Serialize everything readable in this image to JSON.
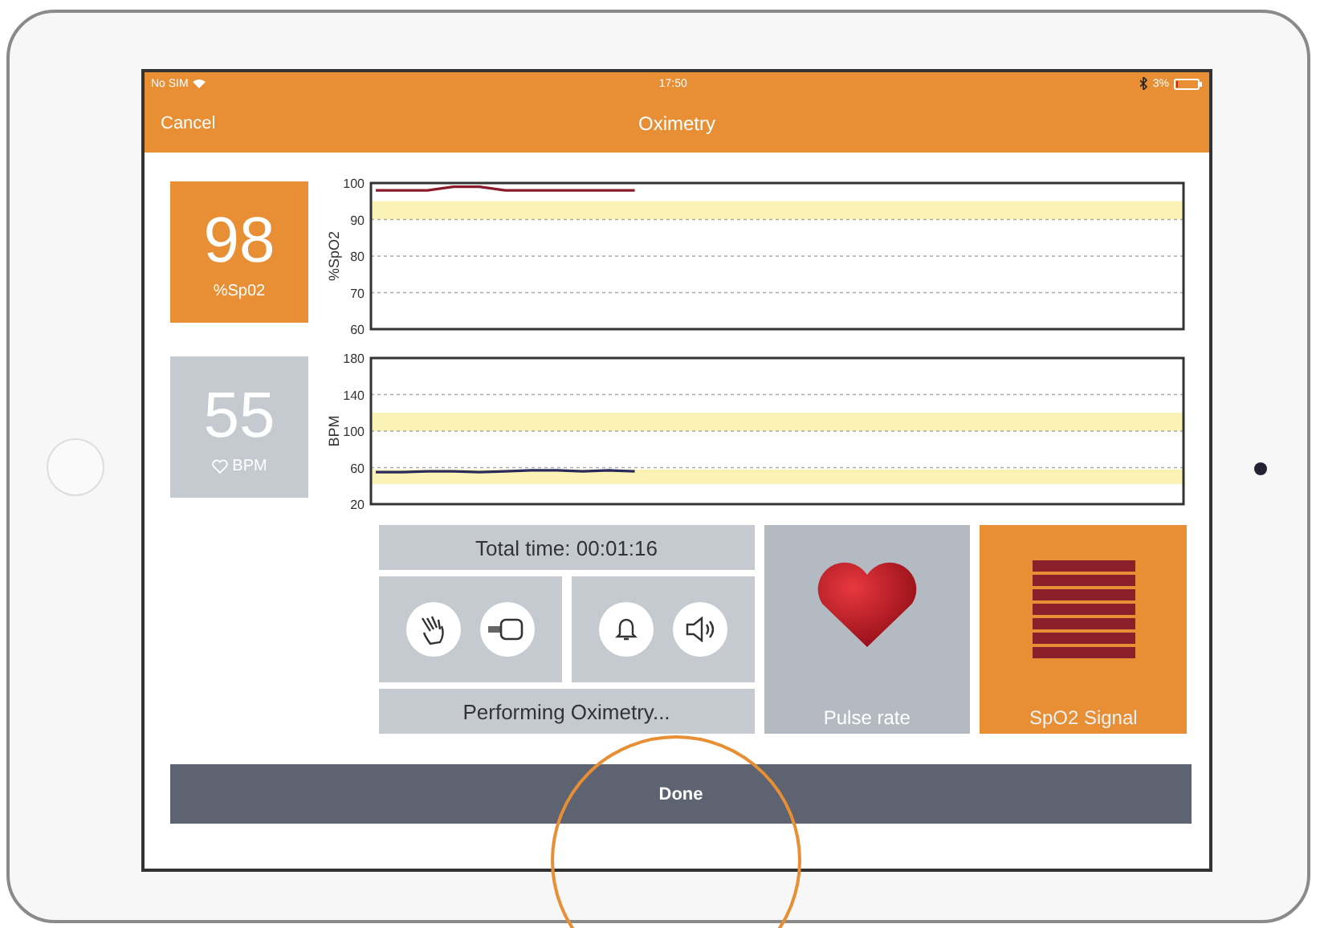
{
  "status_bar": {
    "carrier": "No SIM",
    "time": "17:50",
    "battery": "3%"
  },
  "nav_bar": {
    "left_button": "Cancel",
    "title": "Oximetry"
  },
  "readings": [
    {
      "kind": "spo2",
      "value": "98",
      "unit": "%Sp02",
      "selected": true
    },
    {
      "kind": "pulse",
      "value": "55",
      "unit": "BPM",
      "selected": false
    }
  ],
  "charts": [
    {
      "chart_data": {
        "type": "line",
        "ylabel": "%SpO2",
        "ylim": [
          60,
          100
        ],
        "yticks": [
          60,
          70,
          80,
          90,
          100
        ],
        "grid": true,
        "bands": [
          {
            "axis": "y",
            "from": 90,
            "to": 95
          }
        ],
        "categories": [
          null,
          null,
          null,
          null,
          null,
          null,
          null,
          null,
          null,
          null,
          null,
          null,
          null,
          null,
          null,
          null,
          null,
          null,
          null,
          null,
          null,
          null,
          null,
          null,
          null,
          null,
          null,
          null,
          null,
          null,
          null,
          null
        ],
        "series": [
          {
            "color": "#8b1a2b",
            "values": [
              98,
              98,
              98,
              99,
              99,
              98,
              98,
              98,
              98,
              98,
              98,
              null,
              null,
              null,
              null,
              null,
              null,
              null,
              null,
              null,
              null,
              null,
              null,
              null,
              null,
              null,
              null,
              null,
              null,
              null,
              null,
              null
            ]
          }
        ]
      }
    },
    {
      "chart_data": {
        "type": "line",
        "ylabel": "BPM",
        "ylim": [
          20,
          180
        ],
        "yticks": [
          20,
          60,
          100,
          140,
          180
        ],
        "grid": true,
        "bands": [
          {
            "axis": "y",
            "from": 100,
            "to": 120
          },
          {
            "axis": "y",
            "from": 42,
            "to": 58
          }
        ],
        "categories": [
          null,
          null,
          null,
          null,
          null,
          null,
          null,
          null,
          null,
          null,
          null,
          null,
          null,
          null,
          null,
          null,
          null,
          null,
          null,
          null,
          null,
          null,
          null,
          null,
          null,
          null,
          null,
          null,
          null,
          null,
          null,
          null
        ],
        "series": [
          {
            "color": "#2a2a5a",
            "values": [
              55,
              55,
              56,
              56,
              55,
              56,
              57,
              57,
              56,
              57,
              56,
              null,
              null,
              null,
              null,
              null,
              null,
              null,
              null,
              null,
              null,
              null,
              null,
              null,
              null,
              null,
              null,
              null,
              null,
              null,
              null,
              null
            ]
          }
        ]
      }
    }
  ],
  "total_time": "Total time: 00:01:16",
  "control_groups": [
    [
      {
        "kind": "hand"
      },
      {
        "kind": "sensor"
      }
    ],
    [
      {
        "kind": "bell"
      },
      {
        "kind": "speaker"
      }
    ]
  ],
  "status_text": "Performing Oximetry...",
  "tiles": [
    {
      "kind": "heart",
      "label": "Pulse rate",
      "selected": false
    },
    {
      "kind": "signal",
      "label": "SpO2 Signal",
      "selected": true,
      "level": 1
    }
  ],
  "done_button": "Done"
}
